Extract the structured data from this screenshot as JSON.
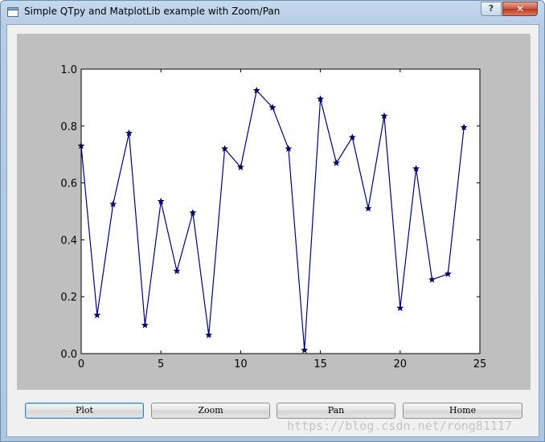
{
  "window": {
    "title": "Simple QTpy and MatplotLib example with Zoom/Pan",
    "help_label": "?",
    "close_label": "✕"
  },
  "buttons": {
    "plot": "Plot",
    "zoom": "Zoom",
    "pan": "Pan",
    "home": "Home"
  },
  "watermark": "https://blog.csdn.net/rong81117",
  "colors": {
    "line": "#000080",
    "figure_bg": "#bfbfbf",
    "axes_bg": "#ffffff"
  },
  "chart_data": {
    "type": "line",
    "marker": "star",
    "title": "",
    "xlabel": "",
    "ylabel": "",
    "xlim": [
      0,
      25
    ],
    "ylim": [
      0.0,
      1.0
    ],
    "xticks": [
      0,
      5,
      10,
      15,
      20,
      25
    ],
    "xtick_labels": [
      "0",
      "5",
      "10",
      "15",
      "20",
      "25"
    ],
    "yticks": [
      0.0,
      0.2,
      0.4,
      0.6,
      0.8,
      1.0
    ],
    "ytick_labels": [
      "0.0",
      "0.2",
      "0.4",
      "0.6",
      "0.8",
      "1.0"
    ],
    "grid": false,
    "x": [
      0,
      1,
      2,
      3,
      4,
      5,
      6,
      7,
      8,
      9,
      10,
      11,
      12,
      13,
      14,
      15,
      16,
      17,
      18,
      19,
      20,
      21,
      22,
      23,
      24
    ],
    "y": [
      0.73,
      0.135,
      0.525,
      0.775,
      0.1,
      0.535,
      0.29,
      0.495,
      0.065,
      0.72,
      0.655,
      0.925,
      0.865,
      0.72,
      0.012,
      0.895,
      0.67,
      0.76,
      0.51,
      0.835,
      0.16,
      0.65,
      0.26,
      0.28,
      0.795
    ]
  }
}
